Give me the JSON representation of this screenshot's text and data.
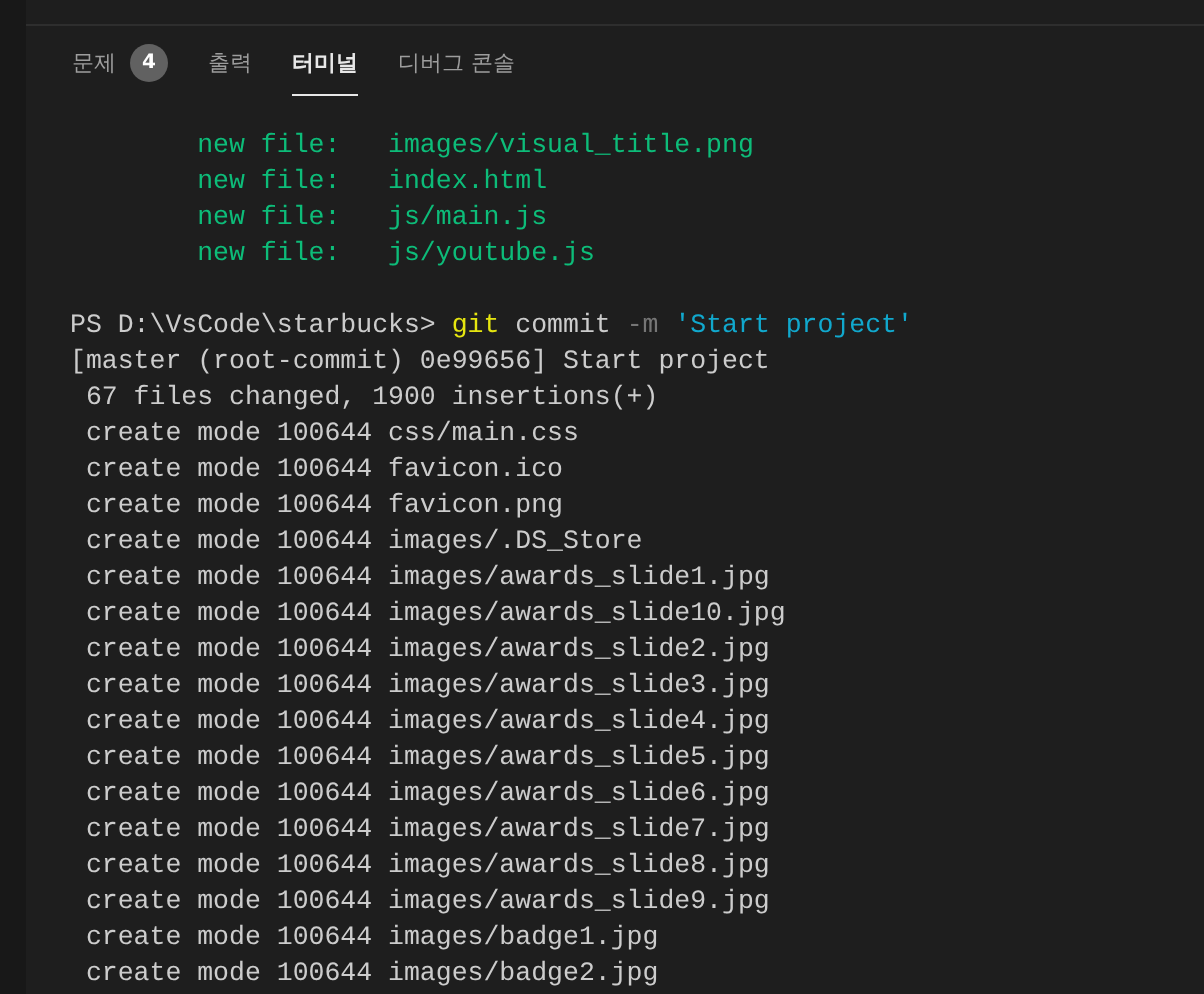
{
  "tabs": [
    {
      "label": "문제",
      "badge": "4",
      "selected": false
    },
    {
      "label": "출력",
      "selected": false
    },
    {
      "label": "터미널",
      "selected": true
    },
    {
      "label": "디버그 콘솔",
      "selected": false
    }
  ],
  "terminal": {
    "lines": [
      [
        {
          "kind": "added",
          "text": "        new file:   images/visual_title.png"
        }
      ],
      [
        {
          "kind": "added",
          "text": "        new file:   index.html"
        }
      ],
      [
        {
          "kind": "added",
          "text": "        new file:   js/main.js"
        }
      ],
      [
        {
          "kind": "added",
          "text": "        new file:   js/youtube.js"
        }
      ],
      [
        {
          "kind": "blank"
        }
      ],
      [
        {
          "kind": "plain",
          "text": "PS D:\\VsCode\\starbucks> "
        },
        {
          "kind": "command",
          "text": "git"
        },
        {
          "kind": "plain",
          "text": " commit "
        },
        {
          "kind": "flag",
          "text": "-m "
        },
        {
          "kind": "string",
          "text": "'Start project'"
        }
      ],
      [
        {
          "kind": "plain",
          "text": "[master (root-commit) 0e99656] Start project"
        }
      ],
      [
        {
          "kind": "plain",
          "text": " 67 files changed, 1900 insertions(+)"
        }
      ],
      [
        {
          "kind": "plain",
          "text": " create mode 100644 css/main.css"
        }
      ],
      [
        {
          "kind": "plain",
          "text": " create mode 100644 favicon.ico"
        }
      ],
      [
        {
          "kind": "plain",
          "text": " create mode 100644 favicon.png"
        }
      ],
      [
        {
          "kind": "plain",
          "text": " create mode 100644 images/.DS_Store"
        }
      ],
      [
        {
          "kind": "plain",
          "text": " create mode 100644 images/awards_slide1.jpg"
        }
      ],
      [
        {
          "kind": "plain",
          "text": " create mode 100644 images/awards_slide10.jpg"
        }
      ],
      [
        {
          "kind": "plain",
          "text": " create mode 100644 images/awards_slide2.jpg"
        }
      ],
      [
        {
          "kind": "plain",
          "text": " create mode 100644 images/awards_slide3.jpg"
        }
      ],
      [
        {
          "kind": "plain",
          "text": " create mode 100644 images/awards_slide4.jpg"
        }
      ],
      [
        {
          "kind": "plain",
          "text": " create mode 100644 images/awards_slide5.jpg"
        }
      ],
      [
        {
          "kind": "plain",
          "text": " create mode 100644 images/awards_slide6.jpg"
        }
      ],
      [
        {
          "kind": "plain",
          "text": " create mode 100644 images/awards_slide7.jpg"
        }
      ],
      [
        {
          "kind": "plain",
          "text": " create mode 100644 images/awards_slide8.jpg"
        }
      ],
      [
        {
          "kind": "plain",
          "text": " create mode 100644 images/awards_slide9.jpg"
        }
      ],
      [
        {
          "kind": "plain",
          "text": " create mode 100644 images/badge1.jpg"
        }
      ],
      [
        {
          "kind": "plain",
          "text": " create mode 100644 images/badge2.jpg"
        }
      ]
    ]
  }
}
